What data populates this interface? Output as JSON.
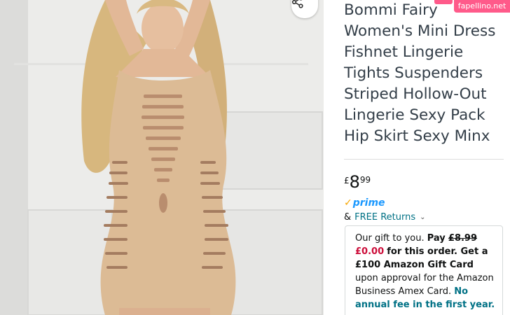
{
  "product": {
    "title_lines": [
      "Bommi Fairy",
      "Women's Mini Dress",
      "Fishnet Lingerie",
      "Tights Suspenders",
      "Striped Hollow-Out",
      "Lingerie Sexy Pack",
      "Hip Skirt Sexy Minx"
    ],
    "image_alt": "product-photo"
  },
  "price": {
    "symbol": "£",
    "whole": "8",
    "fraction": "99"
  },
  "prime": {
    "check": "✓",
    "label": "prime"
  },
  "returns": {
    "prefix": "&",
    "label": "FREE Returns",
    "chevron": "⌄"
  },
  "offer": {
    "text1": "Our gift to you. ",
    "pay": "Pay",
    "old_price": "£8.99",
    "new_price": "£0.00",
    "text2": "for this order. Get a £100 Amazon Gift Card",
    "text3": " upon approval for the Amazon Business Amex Card.",
    "no_fee": "No annual fee in the first year."
  },
  "watermark": {
    "text": "fapellino.net"
  },
  "icons": {
    "share": "share-icon"
  },
  "colors": {
    "link": "#007185",
    "prime_blue": "#1a98ff",
    "prime_check": "#f7a600",
    "deal_red": "#cc0c39",
    "title": "#333e48"
  }
}
